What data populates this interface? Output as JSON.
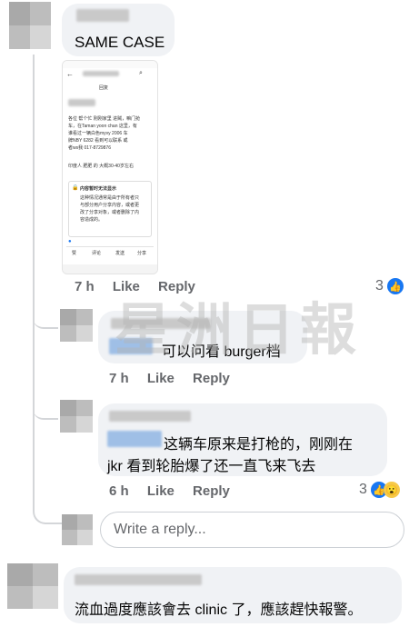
{
  "comments": [
    {
      "text": "SAME CASE",
      "time": "7 h",
      "like_label": "Like",
      "reply_label": "Reply",
      "reaction_count": "3"
    },
    {
      "text": "可以问看 burger档",
      "time": "7 h",
      "like_label": "Like",
      "reply_label": "Reply"
    },
    {
      "text_line1": "这辆车原来是打枪的，刚刚在",
      "text_line2": "jkr 看到轮胎爆了还一直飞来飞去",
      "time": "6 h",
      "like_label": "Like",
      "reply_label": "Reply",
      "reaction_count": "3"
    },
    {
      "text": "流血過度應該會去 clinic 了，應該趕快報警。"
    }
  ],
  "reply_box": {
    "placeholder": "Write a reply..."
  },
  "embedded_screenshot": {
    "tab_label": "回复",
    "body_lines": [
      "各位 帮个忙 刚刚家里 进贼，嘛门抢",
      "车，在Taman yoon chan 这里，有",
      "谁看过一辆白色myvy 2006 车",
      "牌NBY 6282 看到可以联系 或",
      "者ws我 017-8729876",
      "印度人 肥肥 的 大概30-40岁左右"
    ],
    "notice_title": "内容暂时无法显示",
    "notice_lines": [
      "这种情况通常是由于所有者只",
      "与部分用户分享内容，或者更",
      "改了分享对象，或者删除了内",
      "容造成的。"
    ],
    "actions": [
      "赞",
      "评论",
      "发送",
      "分享"
    ]
  },
  "watermark": "星洲日報",
  "colors": {
    "like_blue": "#1877f2",
    "bubble_bg": "#f0f2f5",
    "meta_gray": "#65676b"
  }
}
